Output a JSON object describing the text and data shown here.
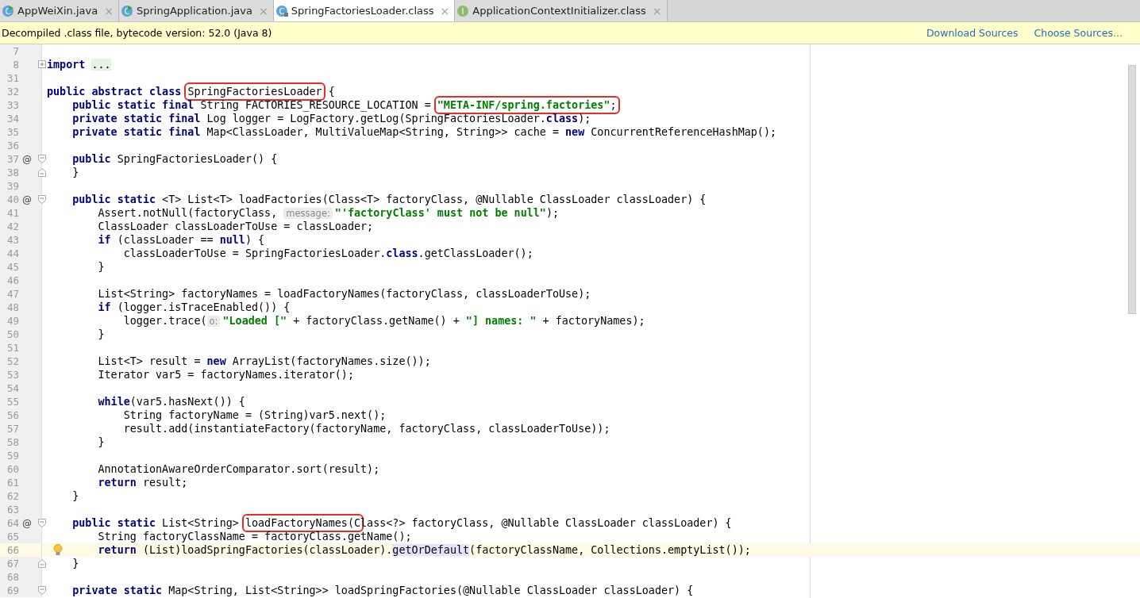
{
  "tabs": [
    {
      "label": "AppWeiXin.java",
      "kind": "runnable",
      "icon_letter": "C",
      "close": "×",
      "selected": false
    },
    {
      "label": "SpringApplication.java",
      "kind": "runnable",
      "icon_letter": "C",
      "close": "×",
      "selected": false
    },
    {
      "label": "SpringFactoriesLoader.class",
      "kind": "compiled",
      "icon_letter": "C",
      "close": "×",
      "selected": true
    },
    {
      "label": "ApplicationContextInitializer.class",
      "kind": "interface",
      "icon_letter": "I",
      "close": "×",
      "selected": false
    }
  ],
  "banner": {
    "text": "Decompiled .class file, bytecode version: 52.0 (Java 8)",
    "links": [
      "Download Sources",
      "Choose Sources..."
    ]
  },
  "lines": [
    {
      "number": "7",
      "current": false,
      "bulb": false
    },
    {
      "number": "8",
      "current": false,
      "bulb": false,
      "fold": {
        "kind": "collapsed"
      },
      "code": [
        {
          "kind": "keyword",
          "text": "import "
        },
        {
          "kind": "folded",
          "text": "..."
        }
      ]
    },
    {
      "number": "31",
      "current": false,
      "bulb": false
    },
    {
      "number": "32",
      "current": false,
      "bulb": false,
      "code": [
        {
          "kind": "keyword",
          "text": "public abstract class "
        },
        {
          "kind": "box",
          "parts": [
            {
              "kind": "text",
              "text": "SpringFactoriesLoader"
            }
          ]
        },
        {
          "kind": "text",
          "text": " {"
        }
      ]
    },
    {
      "number": "33",
      "current": false,
      "bulb": false,
      "code": [
        {
          "kind": "keyword",
          "text": "    public static final"
        },
        {
          "kind": "text",
          "text": " String FACTORIES_RESOURCE_LOCATION = "
        },
        {
          "kind": "box",
          "parts": [
            {
              "kind": "string",
              "text": "\"META-INF/spring.factories\""
            },
            {
              "kind": "text",
              "text": ";"
            }
          ]
        }
      ]
    },
    {
      "number": "34",
      "current": false,
      "bulb": false,
      "code": [
        {
          "kind": "keyword",
          "text": "    private static final"
        },
        {
          "kind": "text",
          "text": " Log logger = LogFactory.getLog(SpringFactoriesLoader."
        },
        {
          "kind": "keyword",
          "text": "class"
        },
        {
          "kind": "text",
          "text": ");"
        }
      ]
    },
    {
      "number": "35",
      "current": false,
      "bulb": false,
      "code": [
        {
          "kind": "keyword",
          "text": "    private static final"
        },
        {
          "kind": "text",
          "text": " Map<ClassLoader, MultiValueMap<String, String>> cache = "
        },
        {
          "kind": "keyword",
          "text": "new"
        },
        {
          "kind": "text",
          "text": " ConcurrentReferenceHashMap();"
        }
      ]
    },
    {
      "number": "36",
      "current": false,
      "bulb": false
    },
    {
      "number": "37",
      "current": false,
      "bulb": false,
      "marker": "@",
      "fold": {
        "kind": "start"
      },
      "code": [
        {
          "kind": "keyword",
          "text": "    public"
        },
        {
          "kind": "text",
          "text": " SpringFactoriesLoader() {"
        }
      ]
    },
    {
      "number": "38",
      "current": false,
      "bulb": false,
      "fold": {
        "kind": "end"
      },
      "code": [
        {
          "kind": "text",
          "text": "    }"
        }
      ]
    },
    {
      "number": "39",
      "current": false,
      "bulb": false
    },
    {
      "number": "40",
      "current": false,
      "bulb": false,
      "marker": "@",
      "fold": {
        "kind": "start"
      },
      "code": [
        {
          "kind": "keyword",
          "text": "    public static"
        },
        {
          "kind": "text",
          "text": " <T> List<T> loadFactories(Class<T> factoryClass, @Nullable ClassLoader classLoader) {"
        }
      ]
    },
    {
      "number": "41",
      "current": false,
      "bulb": false,
      "code": [
        {
          "kind": "text",
          "text": "        Assert.notNull(factoryClass, "
        },
        {
          "kind": "hint",
          "text": "message:"
        },
        {
          "kind": "string",
          "text": "\"'factoryClass' must not be null\""
        },
        {
          "kind": "text",
          "text": ");"
        }
      ]
    },
    {
      "number": "42",
      "current": false,
      "bulb": false,
      "code": [
        {
          "kind": "text",
          "text": "        ClassLoader classLoaderToUse = classLoader;"
        }
      ]
    },
    {
      "number": "43",
      "current": false,
      "bulb": false,
      "code": [
        {
          "kind": "keyword",
          "text": "        if"
        },
        {
          "kind": "text",
          "text": " (classLoader == "
        },
        {
          "kind": "keyword",
          "text": "null"
        },
        {
          "kind": "text",
          "text": ") {"
        }
      ]
    },
    {
      "number": "44",
      "current": false,
      "bulb": false,
      "code": [
        {
          "kind": "text",
          "text": "            classLoaderToUse = SpringFactoriesLoader."
        },
        {
          "kind": "keyword",
          "text": "class"
        },
        {
          "kind": "text",
          "text": ".getClassLoader();"
        }
      ]
    },
    {
      "number": "45",
      "current": false,
      "bulb": false,
      "code": [
        {
          "kind": "text",
          "text": "        }"
        }
      ]
    },
    {
      "number": "46",
      "current": false,
      "bulb": false
    },
    {
      "number": "47",
      "current": false,
      "bulb": false,
      "code": [
        {
          "kind": "text",
          "text": "        List<String> factoryNames = loadFactoryNames(factoryClass, classLoaderToUse);"
        }
      ]
    },
    {
      "number": "48",
      "current": false,
      "bulb": false,
      "code": [
        {
          "kind": "keyword",
          "text": "        if"
        },
        {
          "kind": "text",
          "text": " (logger.isTraceEnabled()) {"
        }
      ]
    },
    {
      "number": "49",
      "current": false,
      "bulb": false,
      "code": [
        {
          "kind": "text",
          "text": "            logger.trace("
        },
        {
          "kind": "hint",
          "text": "o:"
        },
        {
          "kind": "string",
          "text": "\"Loaded [\""
        },
        {
          "kind": "text",
          "text": " + factoryClass.getName() + "
        },
        {
          "kind": "string",
          "text": "\"] names: \""
        },
        {
          "kind": "text",
          "text": " + factoryNames);"
        }
      ]
    },
    {
      "number": "50",
      "current": false,
      "bulb": false,
      "code": [
        {
          "kind": "text",
          "text": "        }"
        }
      ]
    },
    {
      "number": "51",
      "current": false,
      "bulb": false
    },
    {
      "number": "52",
      "current": false,
      "bulb": false,
      "code": [
        {
          "kind": "text",
          "text": "        List<T> result = "
        },
        {
          "kind": "keyword",
          "text": "new"
        },
        {
          "kind": "text",
          "text": " ArrayList(factoryNames.size());"
        }
      ]
    },
    {
      "number": "53",
      "current": false,
      "bulb": false,
      "code": [
        {
          "kind": "text",
          "text": "        Iterator var5 = factoryNames.iterator();"
        }
      ]
    },
    {
      "number": "54",
      "current": false,
      "bulb": false
    },
    {
      "number": "55",
      "current": false,
      "bulb": false,
      "code": [
        {
          "kind": "keyword",
          "text": "        while"
        },
        {
          "kind": "text",
          "text": "(var5.hasNext()) {"
        }
      ]
    },
    {
      "number": "56",
      "current": false,
      "bulb": false,
      "code": [
        {
          "kind": "text",
          "text": "            String factoryName = (String)var5.next();"
        }
      ]
    },
    {
      "number": "57",
      "current": false,
      "bulb": false,
      "code": [
        {
          "kind": "text",
          "text": "            result.add(instantiateFactory(factoryName, factoryClass, classLoaderToUse));"
        }
      ]
    },
    {
      "number": "58",
      "current": false,
      "bulb": false,
      "code": [
        {
          "kind": "text",
          "text": "        }"
        }
      ]
    },
    {
      "number": "59",
      "current": false,
      "bulb": false
    },
    {
      "number": "60",
      "current": false,
      "bulb": false,
      "code": [
        {
          "kind": "text",
          "text": "        AnnotationAwareOrderComparator.sort(result);"
        }
      ]
    },
    {
      "number": "61",
      "current": false,
      "bulb": false,
      "code": [
        {
          "kind": "keyword",
          "text": "        return"
        },
        {
          "kind": "text",
          "text": " result;"
        }
      ]
    },
    {
      "number": "62",
      "current": false,
      "bulb": false,
      "code": [
        {
          "kind": "text",
          "text": "    }"
        }
      ]
    },
    {
      "number": "63",
      "current": false,
      "bulb": false
    },
    {
      "number": "64",
      "current": false,
      "bulb": false,
      "marker": "@",
      "fold": {
        "kind": "start"
      },
      "code": [
        {
          "kind": "keyword",
          "text": "    public static"
        },
        {
          "kind": "text",
          "text": " List<String> "
        },
        {
          "kind": "box",
          "parts": [
            {
              "kind": "text",
              "text": "loadFactoryNames(C"
            }
          ]
        },
        {
          "kind": "text",
          "text": "lass<?> factoryClass, @Nullable ClassLoader classLoader) {"
        }
      ]
    },
    {
      "number": "65",
      "current": false,
      "bulb": false,
      "code": [
        {
          "kind": "text",
          "text": "        String factoryClassName = factoryClass.getName();"
        }
      ]
    },
    {
      "number": "66",
      "current": true,
      "bulb": true,
      "code": [
        {
          "kind": "keyword",
          "text": "        return"
        },
        {
          "kind": "text",
          "text": " (List)loadSpringFactories(classLoader)."
        },
        {
          "kind": "usage",
          "text": "getOrDefault"
        },
        {
          "kind": "text",
          "text": "(factoryClassName, Collections.emptyList());"
        }
      ]
    },
    {
      "number": "67",
      "current": false,
      "bulb": false,
      "fold": {
        "kind": "end"
      },
      "code": [
        {
          "kind": "text",
          "text": "    }"
        }
      ]
    },
    {
      "number": "68",
      "current": false,
      "bulb": false
    },
    {
      "number": "69",
      "current": false,
      "bulb": false,
      "fold": {
        "kind": "start"
      },
      "code": [
        {
          "kind": "keyword",
          "text": "    private static"
        },
        {
          "kind": "text",
          "text": " Map<String, List<String>> loadSpringFactories(@Nullable ClassLoader classLoader) {"
        }
      ]
    }
  ]
}
